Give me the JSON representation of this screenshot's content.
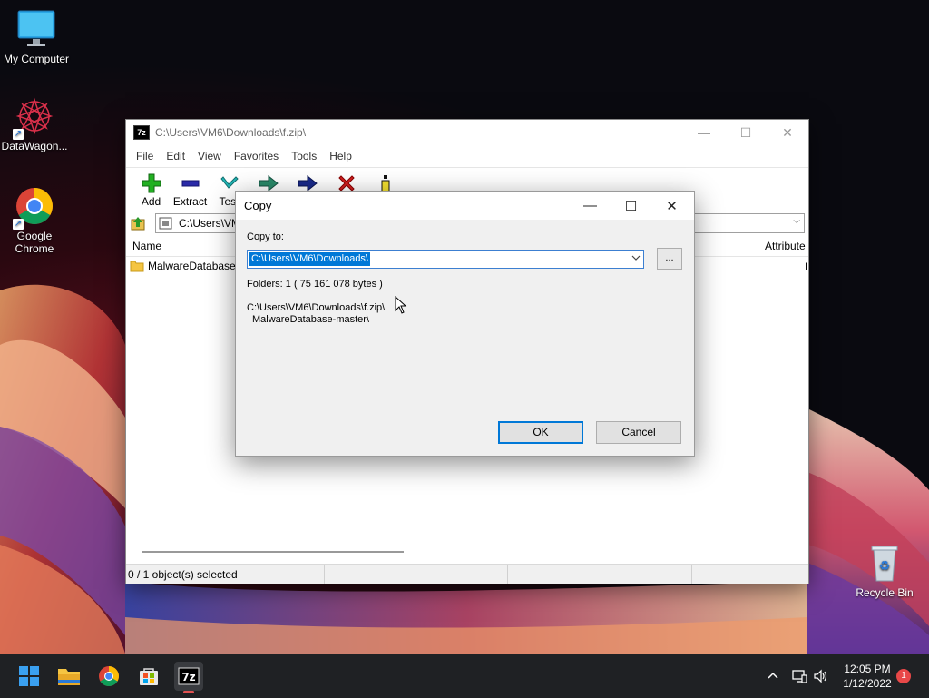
{
  "desktop": {
    "icons": [
      {
        "label": "My Computer"
      },
      {
        "label": "DataWagon..."
      },
      {
        "label": "Google Chrome"
      },
      {
        "label": "Recycle Bin"
      }
    ]
  },
  "sevenzip": {
    "title": "C:\\Users\\VM6\\Downloads\\f.zip\\",
    "menu": [
      "File",
      "Edit",
      "View",
      "Favorites",
      "Tools",
      "Help"
    ],
    "toolbar": [
      "Add",
      "Extract",
      "Test",
      "",
      "",
      "",
      ""
    ],
    "address": "C:\\Users\\VM",
    "columns": {
      "name": "Name",
      "attributes": "Attribute"
    },
    "rows": [
      {
        "name": "MalwareDatabase-",
        "attr": "I"
      }
    ],
    "status": "0 / 1 object(s) selected"
  },
  "copy_dialog": {
    "title": "Copy",
    "copy_to_label": "Copy to:",
    "copy_to_value": "C:\\Users\\VM6\\Downloads\\",
    "browse_label": "...",
    "folders_info": "Folders: 1    ( 75 161 078 bytes )",
    "source_line1": "C:\\Users\\VM6\\Downloads\\f.zip\\",
    "source_line2": "MalwareDatabase-master\\",
    "ok_label": "OK",
    "cancel_label": "Cancel"
  },
  "taskbar": {
    "time": "12:05 PM",
    "date": "1/12/2022",
    "notifications": "1",
    "icons": [
      "start-icon",
      "file-explorer-icon",
      "chrome-icon",
      "store-icon",
      "7zip-icon"
    ]
  },
  "colors": {
    "accent": "#0078d7",
    "taskbar": "#1f2124",
    "dialog_bg": "#f0f0f0"
  }
}
